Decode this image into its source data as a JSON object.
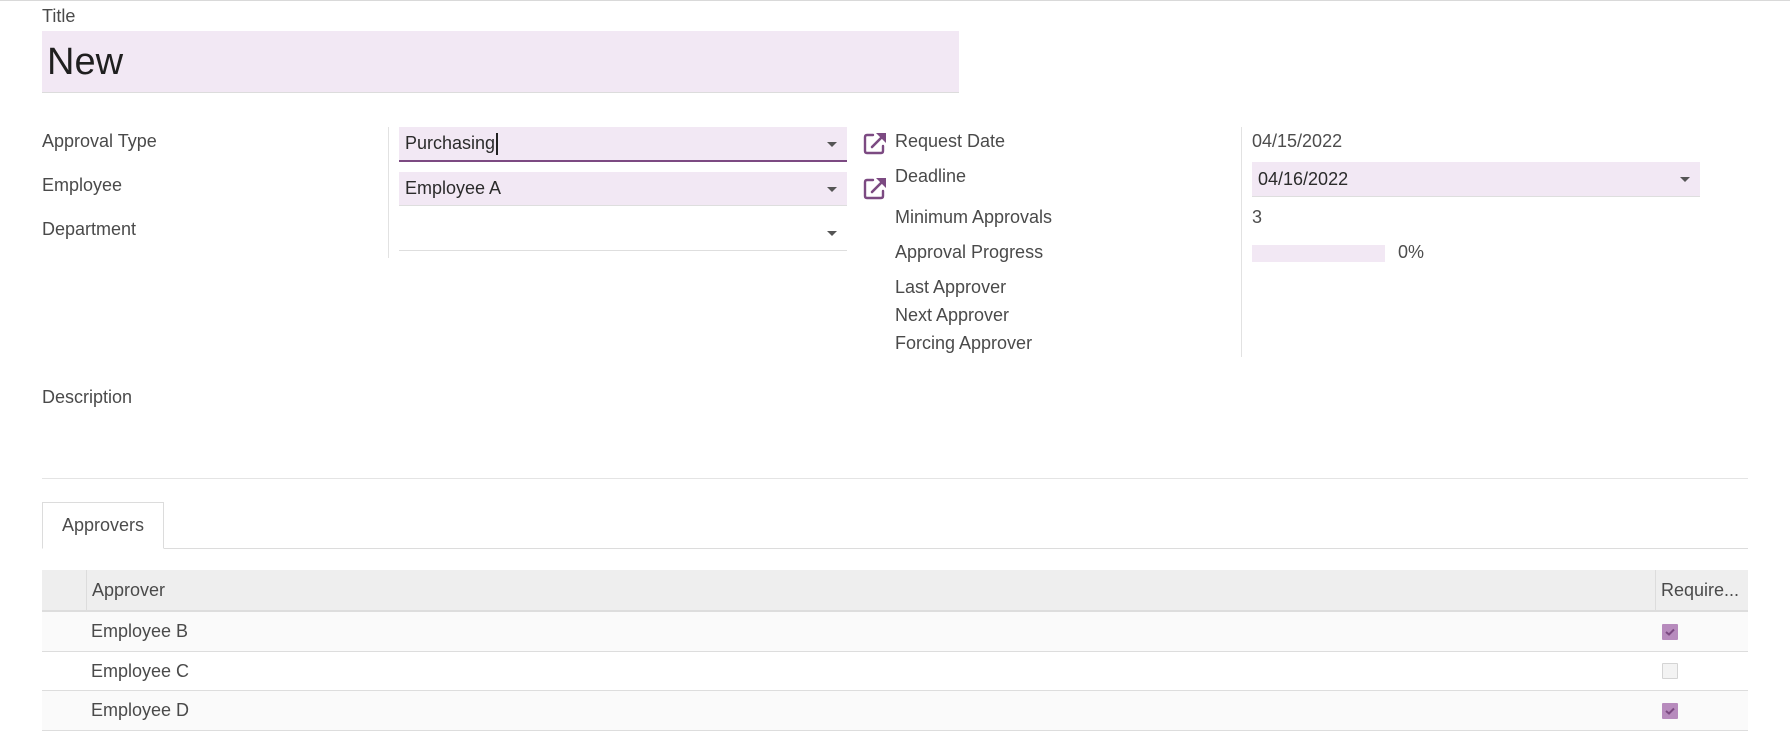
{
  "title": {
    "label": "Title",
    "value": "New"
  },
  "left_fields": [
    {
      "label": "Approval Type",
      "value": "Purchasing",
      "has_external_link": true,
      "focused": true
    },
    {
      "label": "Employee",
      "value": "Employee A",
      "has_external_link": true,
      "focused": false
    },
    {
      "label": "Department",
      "value": "",
      "has_external_link": false,
      "focused": false
    }
  ],
  "right_fields": {
    "request_date": {
      "label": "Request Date",
      "value": "04/15/2022"
    },
    "deadline": {
      "label": "Deadline",
      "value": "04/16/2022"
    },
    "minimum_approvals": {
      "label": "Minimum Approvals",
      "value": "3"
    },
    "approval_progress": {
      "label": "Approval Progress",
      "value": "0%",
      "percent": 0
    },
    "last_approver": {
      "label": "Last Approver",
      "value": ""
    },
    "next_approver": {
      "label": "Next Approver",
      "value": ""
    },
    "forcing_approver": {
      "label": "Forcing Approver",
      "value": ""
    }
  },
  "description": {
    "label": "Description",
    "value": ""
  },
  "tabs": [
    {
      "label": "Approvers",
      "active": true
    }
  ],
  "approvers_table": {
    "columns": [
      "Approver",
      "Require..."
    ],
    "rows": [
      {
        "approver": "Employee B",
        "required": true
      },
      {
        "approver": "Employee C",
        "required": false
      },
      {
        "approver": "Employee D",
        "required": true
      }
    ]
  },
  "icons": {
    "external_link": "external-link-icon",
    "dropdown": "caret-down-icon",
    "checkbox_checked": "check-icon"
  },
  "colors": {
    "accent": "#7c4a82",
    "field_background": "#f2e8f4",
    "checkbox_checked": "#b78bbd"
  }
}
